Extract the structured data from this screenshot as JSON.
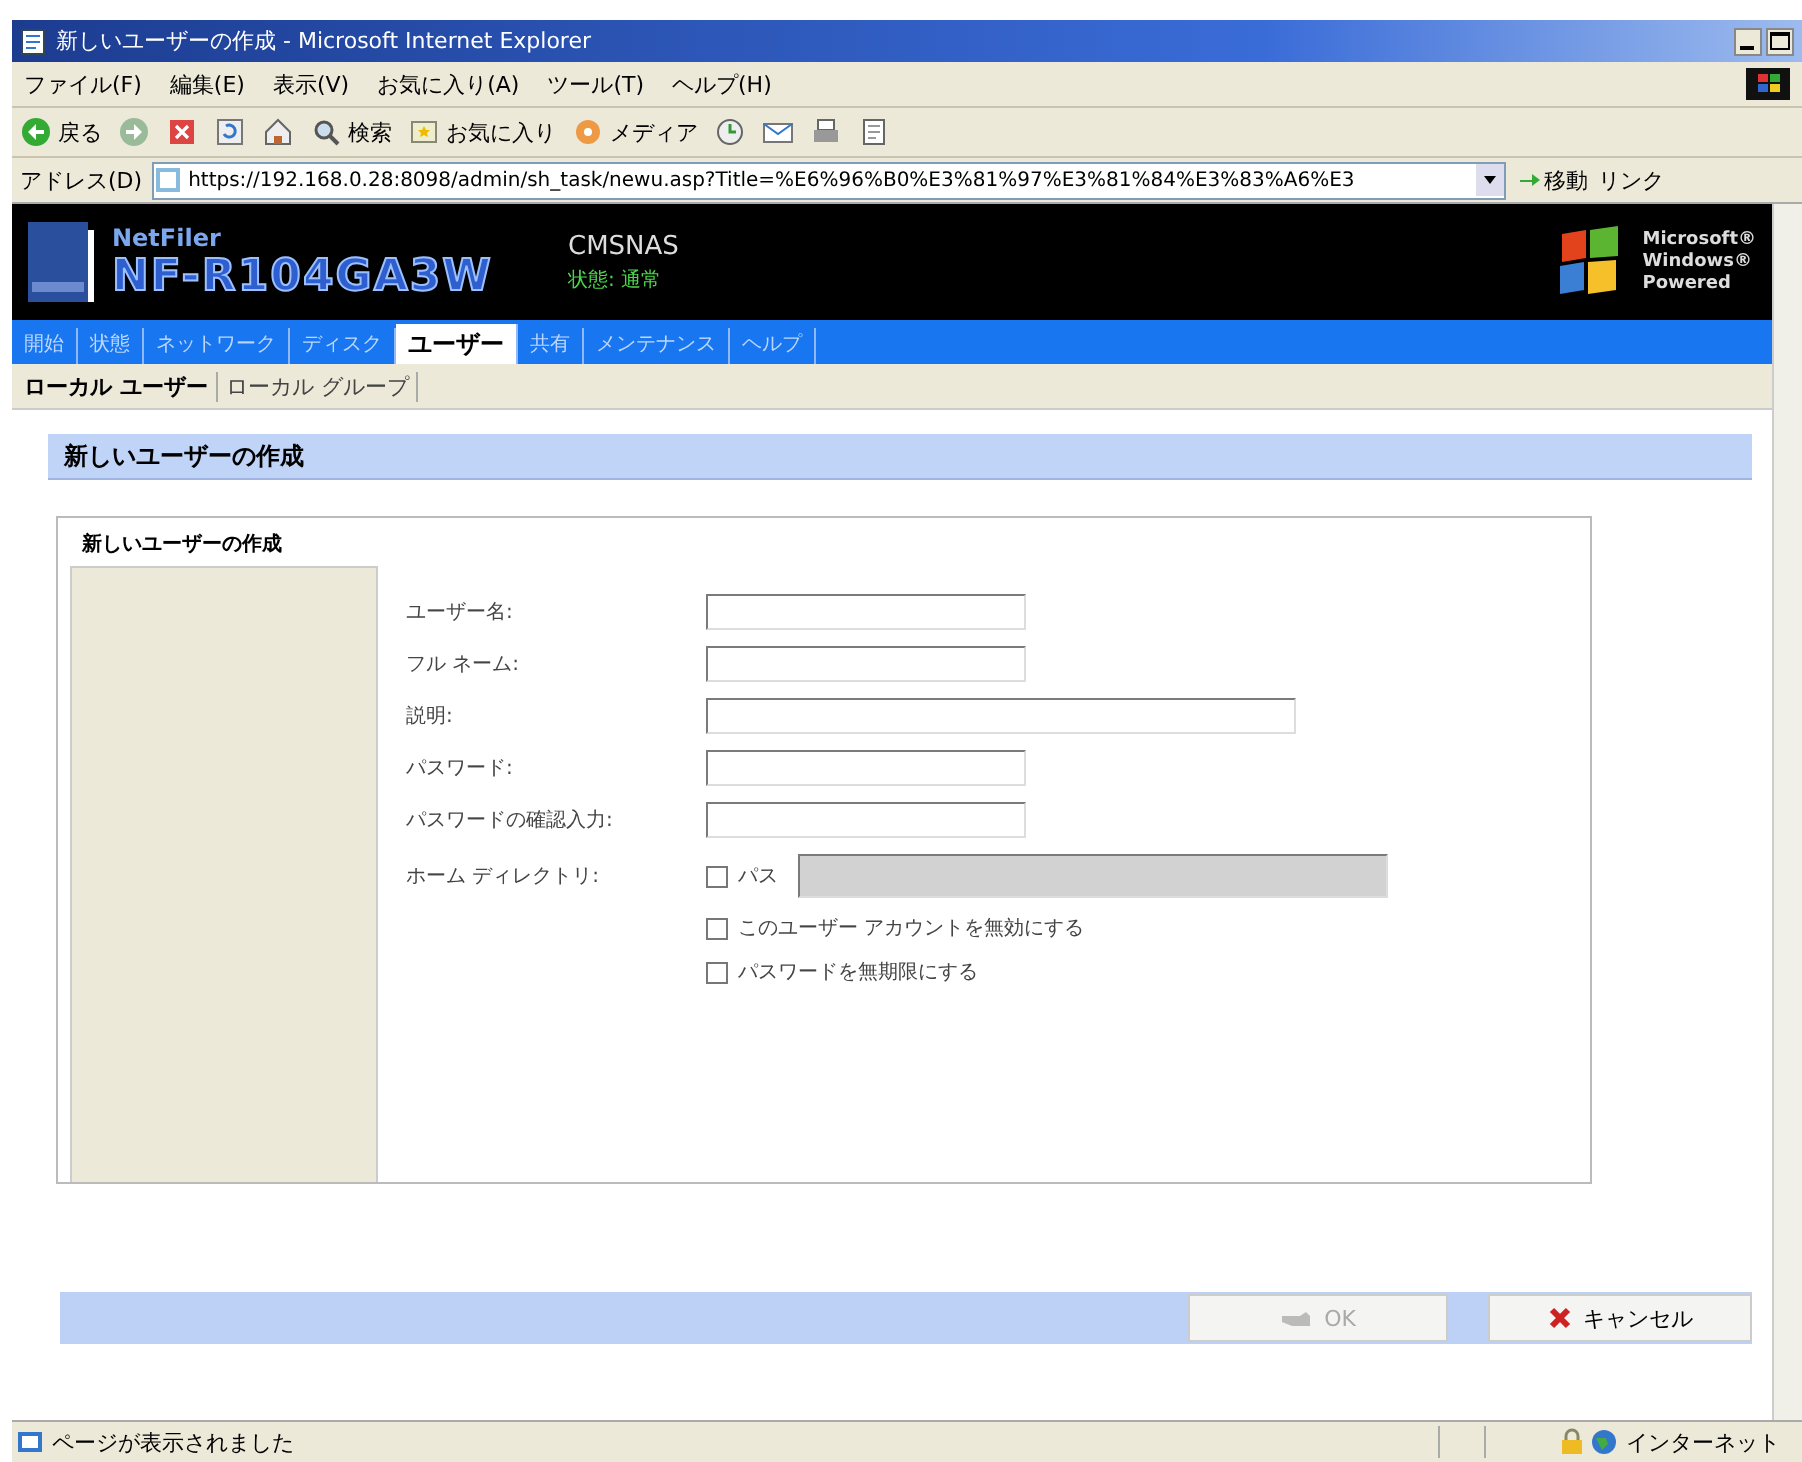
{
  "window": {
    "title": "新しいユーザーの作成 - Microsoft Internet Explorer",
    "menu": [
      "ファイル(F)",
      "編集(E)",
      "表示(V)",
      "お気に入り(A)",
      "ツール(T)",
      "ヘルプ(H)"
    ],
    "toolbar": [
      {
        "kind": "back",
        "label": "戻る"
      },
      {
        "kind": "forward"
      },
      {
        "kind": "stop"
      },
      {
        "kind": "refresh"
      },
      {
        "kind": "home"
      },
      {
        "kind": "search",
        "label": "検索"
      },
      {
        "kind": "favorites",
        "label": "お気に入り"
      },
      {
        "kind": "media",
        "label": "メディア"
      },
      {
        "kind": "history"
      },
      {
        "kind": "mail"
      },
      {
        "kind": "print"
      },
      {
        "kind": "edit"
      }
    ],
    "address": {
      "label": "アドレス(D)",
      "url": "https://192.168.0.28:8098/admin/sh_task/newu.asp?Title=%E6%96%B0%E3%81%97%E3%81%84%E3%83%A6%E3",
      "go": "移動",
      "links": "リンク"
    }
  },
  "header": {
    "brand": "NetFiler",
    "model": "NF-R104GA3W",
    "server": "CMSNAS",
    "status": "状態: 通常",
    "badge": [
      "Microsoft®",
      "Windows®",
      "Powered"
    ]
  },
  "nav": [
    {
      "label": "開始",
      "selected": false
    },
    {
      "label": "状態",
      "selected": false
    },
    {
      "label": "ネットワーク",
      "selected": false
    },
    {
      "label": "ディスク",
      "selected": false
    },
    {
      "label": "ユーザー",
      "selected": true
    },
    {
      "label": "共有",
      "selected": false
    },
    {
      "label": "メンテナンス",
      "selected": false
    },
    {
      "label": "ヘルプ",
      "selected": false
    }
  ],
  "subtabs": [
    {
      "label": "ローカル ユーザー",
      "selected": true
    },
    {
      "label": "ローカル グループ",
      "selected": false
    }
  ],
  "page_title": "新しいユーザーの作成",
  "form": {
    "panel_label": "新しいユーザーの作成",
    "fields": [
      {
        "label": "ユーザー名:",
        "kind": "short"
      },
      {
        "label": "フル ネーム:",
        "kind": "short"
      },
      {
        "label": "説明:",
        "kind": "long"
      },
      {
        "label": "パスワード:",
        "kind": "short"
      },
      {
        "label": "パスワードの確認入力:",
        "kind": "short"
      }
    ],
    "home_dir": {
      "label": "ホーム ディレクトリ:",
      "path_label": "パス",
      "checked": false,
      "path_disabled": true
    },
    "options": [
      {
        "label": "このユーザー アカウントを無効にする",
        "checked": false
      },
      {
        "label": "パスワードを無期限にする",
        "checked": false
      }
    ]
  },
  "buttons": [
    {
      "kind": "ok",
      "label": "OK",
      "disabled": true
    },
    {
      "kind": "cancel",
      "label": "キャンセル",
      "disabled": false
    }
  ],
  "status_bar": {
    "message": "ページが表示されました",
    "zone": "インターネット"
  }
}
